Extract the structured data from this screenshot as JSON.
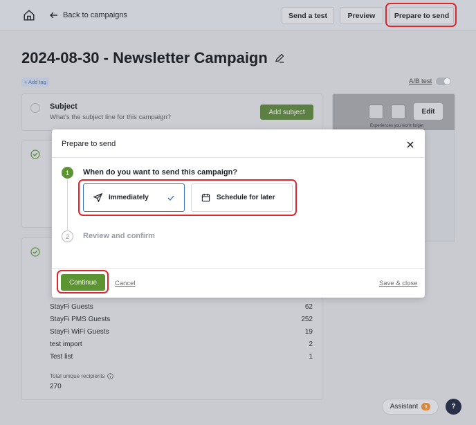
{
  "header": {
    "back_label": "Back to campaigns",
    "send_test_label": "Send a test",
    "preview_label": "Preview",
    "prepare_label": "Prepare to send"
  },
  "page": {
    "title": "2024-08-30 - Newsletter Campaign",
    "add_tag_label": "+ Add tag",
    "ab_test_label": "A/B test"
  },
  "subject": {
    "label": "Subject",
    "hint": "What's the subject line for this campaign?",
    "add_button": "Add subject"
  },
  "email_preview": {
    "edit_label": "Edit",
    "tagline": "Experiences you won't forget"
  },
  "recipients": {
    "lists": [
      {
        "name": "StayFi Guests",
        "count": "62"
      },
      {
        "name": "StayFi PMS Guests",
        "count": "252"
      },
      {
        "name": "StayFi WiFi Guests",
        "count": "19"
      },
      {
        "name": "test import",
        "count": "2"
      },
      {
        "name": "Test list",
        "count": "1"
      }
    ],
    "total_label": "Total unique recipients",
    "total_value": "270"
  },
  "assistant": {
    "label": "Assistant",
    "badge": "1"
  },
  "help_label": "?",
  "modal": {
    "title": "Prepare to send",
    "step1_number": "1",
    "step1_question": "When do you want to send this campaign?",
    "option_immediately": "Immediately",
    "option_schedule": "Schedule for later",
    "step2_number": "2",
    "step2_label": "Review and confirm",
    "continue_label": "Continue",
    "cancel_label": "Cancel",
    "save_close_label": "Save & close"
  },
  "colors": {
    "primary_green": "#5b9431",
    "selection_blue": "#3a72c9",
    "highlight_red": "#e0262a"
  }
}
